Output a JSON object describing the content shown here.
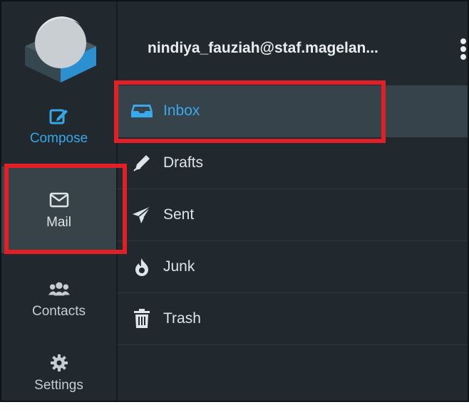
{
  "nav": {
    "items": [
      {
        "label": "Compose",
        "icon": "compose-icon"
      },
      {
        "label": "Mail",
        "icon": "envelope-icon"
      },
      {
        "label": "Contacts",
        "icon": "contacts-icon"
      },
      {
        "label": "Settings",
        "icon": "gear-icon"
      }
    ]
  },
  "account": {
    "email": "nindiya_fauziah@staf.magelan..."
  },
  "folders": [
    {
      "label": "Inbox",
      "icon": "inbox-icon",
      "active": true
    },
    {
      "label": "Drafts",
      "icon": "pencil-icon"
    },
    {
      "label": "Sent",
      "icon": "paper-plane-icon"
    },
    {
      "label": "Junk",
      "icon": "fire-icon"
    },
    {
      "label": "Trash",
      "icon": "trash-icon"
    }
  ],
  "colors": {
    "background": "#22292e",
    "accent": "#37a6e6",
    "active_row": "#36434a",
    "highlight": "#e01f26"
  }
}
